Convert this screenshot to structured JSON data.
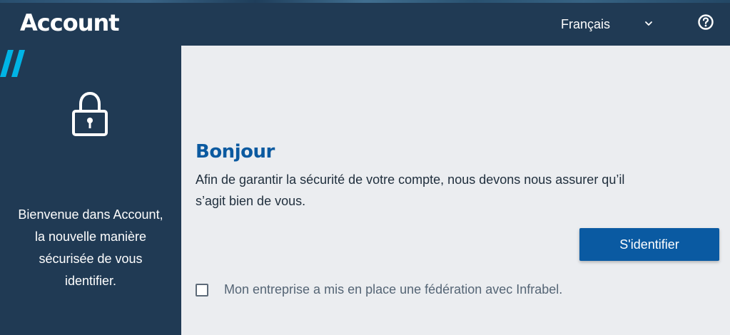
{
  "header": {
    "app_title": "Account",
    "language": {
      "selected": "Français",
      "chevron_icon": "chevron-down-icon"
    },
    "help_icon": "help-circle-icon"
  },
  "sidebar": {
    "decor_icon": "double-slash-icon",
    "lock_icon": "padlock-icon",
    "welcome_lines": [
      "Bienvenue dans Account,",
      "la nouvelle manière",
      "sécurisée de vous",
      "identifier."
    ]
  },
  "main": {
    "heading": "Bonjour",
    "intro_lines": [
      "Afin de garantir la sécurité de votre compte, nous devons nous assurer qu’il",
      "s’agit bien de vous."
    ],
    "signin_label": "S'identifier",
    "federation_checkbox": {
      "label": "Mon entreprise a mis en place une fédération avec Infrabel.",
      "checked": false
    }
  },
  "colors": {
    "header_bg": "#203a54",
    "main_bg": "#ebedf0",
    "accent_blue": "#0a5aa2",
    "heading_blue": "#0b5aa0",
    "decor_cyan": "#00b4e6"
  }
}
